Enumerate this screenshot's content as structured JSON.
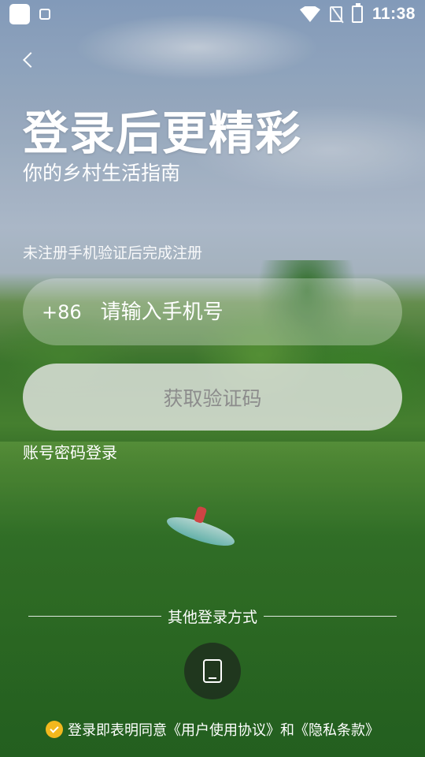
{
  "status_bar": {
    "time": "11:38",
    "icons": [
      "app-square-icon",
      "lock-icon",
      "wifi-icon",
      "no-sim-icon",
      "battery-charging-icon"
    ]
  },
  "header": {
    "back_icon": "chevron-left-icon",
    "title": "登录后更精彩",
    "subtitle": "你的乡村生活指南"
  },
  "form": {
    "hint": "未注册手机验证后完成注册",
    "country_code": "+86",
    "phone_placeholder": "请输入手机号",
    "phone_value": "",
    "get_code_label": "获取验证码",
    "password_login_label": "账号密码登录"
  },
  "other_login": {
    "label": "其他登录方式",
    "icon": "tablet-icon"
  },
  "agreement": {
    "checked": true,
    "text": "登录即表明同意《用户使用协议》和《隐私条款》"
  },
  "colors": {
    "accent": "#f2b81e",
    "code_button_text": "#8c8c8c"
  }
}
